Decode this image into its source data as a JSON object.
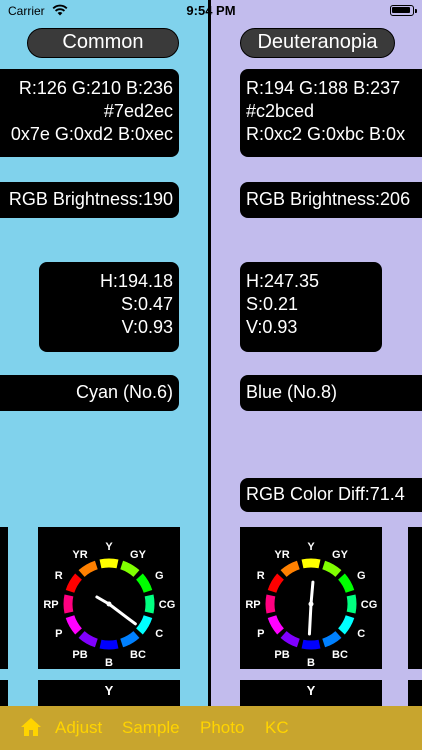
{
  "status_bar": {
    "carrier": "Carrier",
    "time": "9:54 PM"
  },
  "left": {
    "title": "Common",
    "rgb": {
      "l1": "R:126 G:210 B:236",
      "l2": "#7ed2ec",
      "l3": "0x7e G:0xd2 B:0xec"
    },
    "brightness": "RGB Brightness:190",
    "hsv": {
      "h": "H:194.18",
      "s": "S:0.47",
      "v": "V:0.93"
    },
    "color_name": "Cyan (No.6)",
    "bottom_label": "Y",
    "bg_color": "#80d2ec"
  },
  "right": {
    "title": "Deuteranopia",
    "rgb": {
      "l1": "R:194 G:188 B:237",
      "l2": "#c2bced",
      "l3": "R:0xc2 G:0xbc B:0x"
    },
    "brightness": "RGB Brightness:206",
    "hsv": {
      "h": "H:247.35",
      "s": "S:0.21",
      "v": "V:0.93"
    },
    "color_name": "Blue (No.8)",
    "color_diff": "RGB Color Diff:71.4",
    "bottom_label": "Y",
    "bg_color": "#c2bced"
  },
  "wheel_labels": [
    "Y",
    "GY",
    "G",
    "CG",
    "C",
    "BC",
    "B",
    "PB",
    "P",
    "RP",
    "R",
    "YR"
  ],
  "tabs": {
    "home": "home-icon",
    "adjust": "Adjust",
    "sample": "Sample",
    "photo": "Photo",
    "kc": "KC"
  },
  "colors": {
    "accent": "#ffd400",
    "tab_bar": "#c8a52e"
  }
}
